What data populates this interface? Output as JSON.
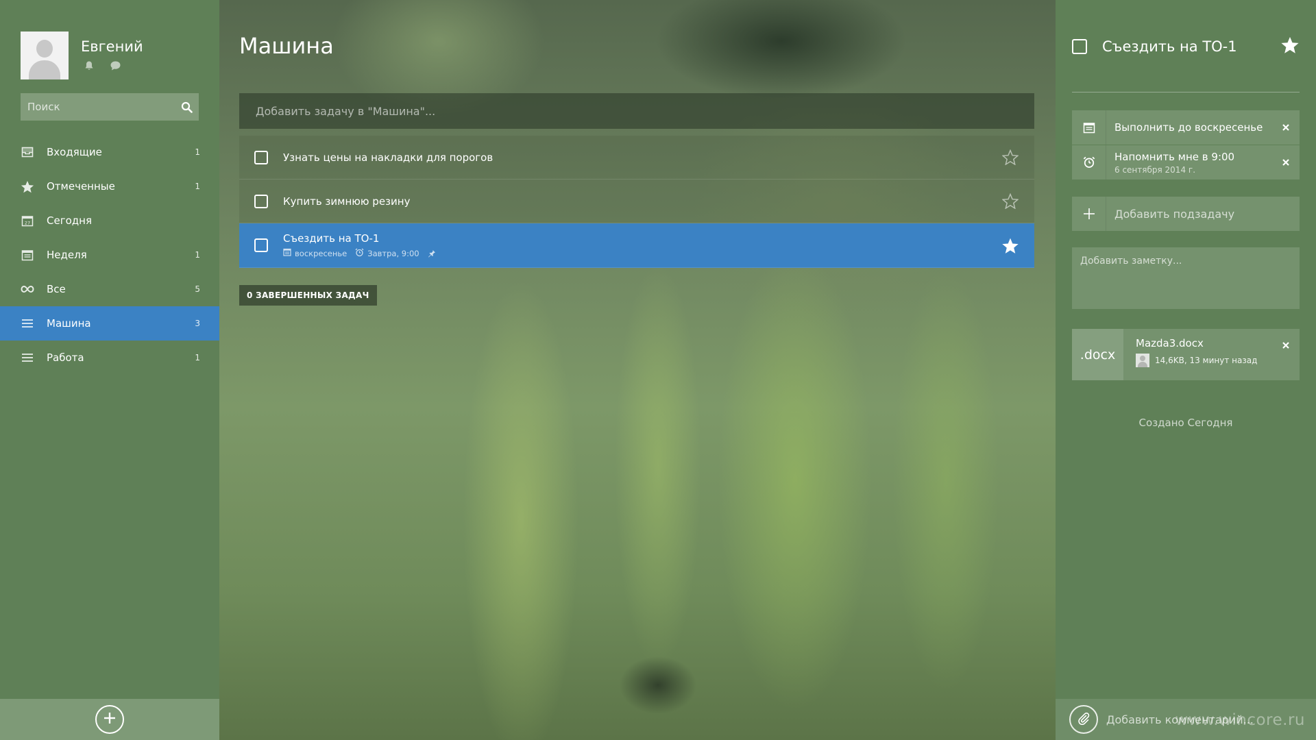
{
  "profile": {
    "name": "Евгений",
    "icons": [
      "bell-icon",
      "chat-icon"
    ]
  },
  "search": {
    "placeholder": "Поиск",
    "icon": "search-icon"
  },
  "sidebar": {
    "items": [
      {
        "label": "Входящие",
        "count": "1",
        "icon": "inbox-icon"
      },
      {
        "label": "Отмеченные",
        "count": "1",
        "icon": "star-icon"
      },
      {
        "label": "Сегодня",
        "count": "",
        "icon": "calendar-today-icon"
      },
      {
        "label": "Неделя",
        "count": "1",
        "icon": "calendar-week-icon"
      },
      {
        "label": "Все",
        "count": "5",
        "icon": "infinity-icon"
      },
      {
        "label": "Машина",
        "count": "3",
        "icon": "list-icon",
        "active": true
      },
      {
        "label": "Работа",
        "count": "1",
        "icon": "list-icon"
      }
    ],
    "footer_icon": "add-list-icon"
  },
  "main": {
    "title": "Машина",
    "add_task_placeholder": "Добавить задачу в \"Машина\"...",
    "tasks": [
      {
        "title": "Узнать цены на накладки для порогов",
        "starred": false
      },
      {
        "title": "Купить зимнюю резину",
        "starred": false
      },
      {
        "title": "Съездить на ТО-1",
        "starred": true,
        "selected": true,
        "due": "воскресенье",
        "reminder": "Завтра, 9:00"
      }
    ],
    "completed_label": "0 ЗАВЕРШЕННЫХ ЗАДАЧ"
  },
  "detail": {
    "title": "Съездить на ТО-1",
    "due_label": "Выполнить до воскресенье",
    "reminder_label": "Напомнить мне в 9:00",
    "reminder_date": "6 сентября 2014 г.",
    "subtask_placeholder": "Добавить подзадачу",
    "note_placeholder": "Добавить заметку...",
    "file": {
      "ext": ".docx",
      "name": "Mazda3.docx",
      "meta": "14,6KB, 13 минут назад"
    },
    "created": "Создано Сегодня",
    "comment_placeholder": "Добавить комментарий..."
  },
  "watermark": "www.wincore.ru",
  "colors": {
    "accent": "#3b82c4",
    "sidebar": "#5f8057"
  }
}
